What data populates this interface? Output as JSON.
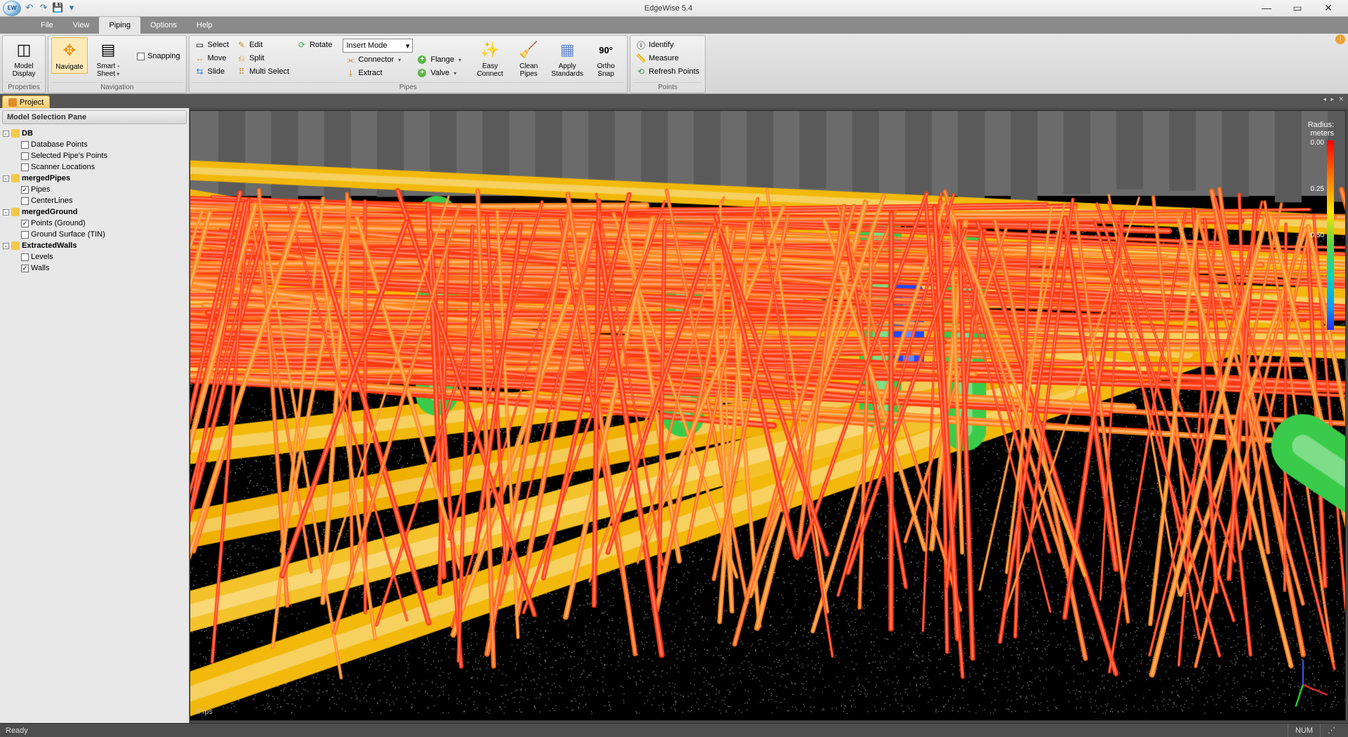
{
  "app": {
    "title": "EdgeWise 5.4"
  },
  "qat": {
    "undo": "↶",
    "redo": "↷",
    "save": "💾",
    "more": "▾"
  },
  "win": {
    "min": "—",
    "max": "▭",
    "close": "✕"
  },
  "menu": {
    "file": "File",
    "view": "View",
    "piping": "Piping",
    "options": "Options",
    "help": "Help"
  },
  "ribbon": {
    "properties": {
      "label": "Properties",
      "model_display": "Model\nDisplay"
    },
    "navigation": {
      "label": "Navigation",
      "navigate": "Navigate",
      "smart_sheet": "Smart -\nSheet",
      "snapping": "Snapping"
    },
    "pipes": {
      "label": "Pipes",
      "select": "Select",
      "move": "Move",
      "slide": "Slide",
      "edit": "Edit",
      "rotate": "Rotate",
      "split": "Split",
      "multi_select": "Multi Select",
      "insert_mode": "Insert Mode",
      "connector": "Connector",
      "extract": "Extract",
      "flange": "Flange",
      "valve": "Valve",
      "easy_connect": "Easy\nConnect",
      "clean_pipes": "Clean\nPipes",
      "apply_standards": "Apply\nStandards",
      "ortho_snap": "Ortho\nSnap"
    },
    "points": {
      "label": "Points",
      "identify": "Identify",
      "measure": "Measure",
      "refresh": "Refresh Points"
    }
  },
  "doc_tab": {
    "name": "Project"
  },
  "pane": {
    "title": "Model Selection Pane",
    "tree": {
      "db": {
        "name": "DB",
        "database_points": "Database Points",
        "selected_pipes_points": "Selected Pipe's Points",
        "scanner_locations": "Scanner Locations"
      },
      "merged_pipes": {
        "name": "mergedPipes",
        "pipes": "Pipes",
        "centerlines": "CenterLines"
      },
      "merged_ground": {
        "name": "mergedGround",
        "points_ground": "Points (Ground)",
        "ground_surface": "Ground Surface (TIN)"
      },
      "extracted_walls": {
        "name": "ExtractedWalls",
        "levels": "Levels",
        "walls": "Walls"
      }
    }
  },
  "viewport": {
    "fps": "4 fps",
    "legend": {
      "title": "Radius: meters",
      "t0": "0.00",
      "t1": "0.25",
      "t2": "0.50"
    }
  },
  "status": {
    "ready": "Ready",
    "num": "NUM"
  }
}
